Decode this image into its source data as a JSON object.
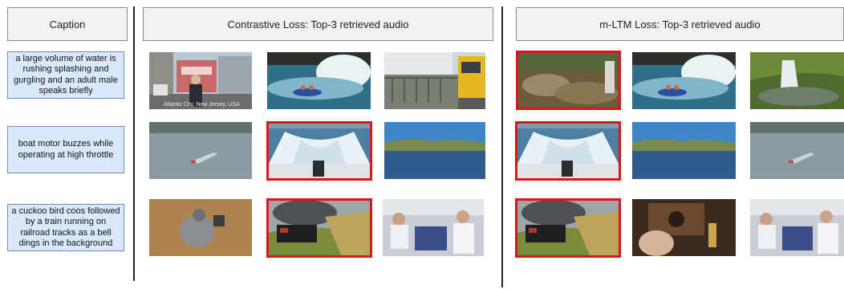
{
  "headers": {
    "caption": "Caption",
    "contrastive": "Contrastive Loss: Top-3 retrieved audio",
    "mltm": "m-LTM Loss: Top-3 retrieved audio"
  },
  "captions": [
    "a large volume of water is rushing splashing and gurgling and an adult male speaks briefly",
    "boat motor buzzes while operating at high throttle",
    "a cuckoo bird coos followed by a train running on railroad tracks as a bell dings in the background"
  ],
  "thumbnail_watermark": "Atlantic City, New Jersey, USA",
  "colors": {
    "highlight": "#d7191c",
    "caption_fill": "#dae8fc",
    "caption_border": "#6c8ebf",
    "header_fill": "#f2f2f2"
  },
  "retrievals": {
    "contrastive": [
      [
        {
          "scene": "city-street-presenter",
          "correct": false
        },
        {
          "scene": "waterfall-rafting",
          "correct": false
        },
        {
          "scene": "train-station",
          "correct": false
        }
      ],
      [
        {
          "scene": "speedboat-lake",
          "correct": false
        },
        {
          "scene": "boat-wake-stern",
          "correct": true
        },
        {
          "scene": "lake-shoreline",
          "correct": false
        }
      ],
      [
        {
          "scene": "pigeon",
          "correct": false
        },
        {
          "scene": "steam-train",
          "correct": true
        },
        {
          "scene": "lab-workers",
          "correct": false
        }
      ]
    ],
    "mltm": [
      [
        {
          "scene": "river-rocks",
          "correct": true
        },
        {
          "scene": "waterfall-rafting",
          "correct": false
        },
        {
          "scene": "forest-waterfall",
          "correct": false
        }
      ],
      [
        {
          "scene": "boat-wake-stern",
          "correct": true
        },
        {
          "scene": "lake-shoreline",
          "correct": false
        },
        {
          "scene": "speedboat-lake",
          "correct": false
        }
      ],
      [
        {
          "scene": "steam-train",
          "correct": true
        },
        {
          "scene": "cuckoo-clock",
          "correct": false
        },
        {
          "scene": "lab-workers",
          "correct": false
        }
      ]
    ]
  }
}
